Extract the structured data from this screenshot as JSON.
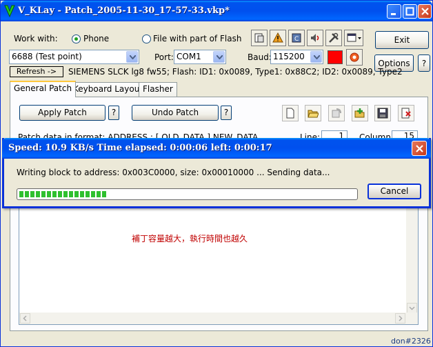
{
  "window": {
    "title": "V_KLay - Patch_2005-11-30_17-57-33.vkp*"
  },
  "work_with": {
    "label": "Work with:",
    "option_phone": "Phone",
    "option_file": "File with part of Flash",
    "selected": "Phone"
  },
  "buttons": {
    "exit": "Exit",
    "options": "Options",
    "help": "?",
    "refresh": "Refresh ->",
    "apply_patch": "Apply Patch",
    "undo_patch": "Undo Patch",
    "apply_help": "?",
    "undo_help": "?"
  },
  "connection": {
    "device": "6688 (Test point)",
    "port_label": "Port:",
    "port": "COM1",
    "baud_label": "Baud:",
    "baud": "115200",
    "status_color": "#ff0000"
  },
  "info_line": "SIEMENS SLCK lg8 fw55; Flash: ID1: 0x0089, Type1: 0x88C2; ID2: 0x0089, Type2",
  "tabs": [
    {
      "label": "General Patch",
      "active": true
    },
    {
      "label": "Keyboard Layout",
      "active": false
    },
    {
      "label": "Flasher",
      "active": false
    }
  ],
  "patch": {
    "format_text": "Patch data in format:  ADDRESS : [ OLD_DATA ]  NEW_DATA",
    "line_label": "Line:",
    "line_value": "1",
    "column_label": "Column:",
    "column_value": "15"
  },
  "editor": {
    "note": "補丁容量越大，執行時間也越久"
  },
  "dialog": {
    "title": "Speed: 10.9 KB/s  Time elapsed: 0:00:06  left: 0:00:17",
    "message": "Writing block to address: 0x003C0000, size: 0x00010000 ... Sending data...",
    "progress": 0.26,
    "cancel": "Cancel"
  },
  "signature": "don#2326",
  "icons": {
    "toolbar": [
      "phone-book-icon",
      "warning-icon",
      "chip-icon",
      "speaker-icon",
      "tools-icon",
      "window-icon"
    ],
    "file": [
      "new-file-icon",
      "open-folder-icon",
      "reload-icon",
      "add-icon",
      "save-icon",
      "exit-icon"
    ]
  }
}
